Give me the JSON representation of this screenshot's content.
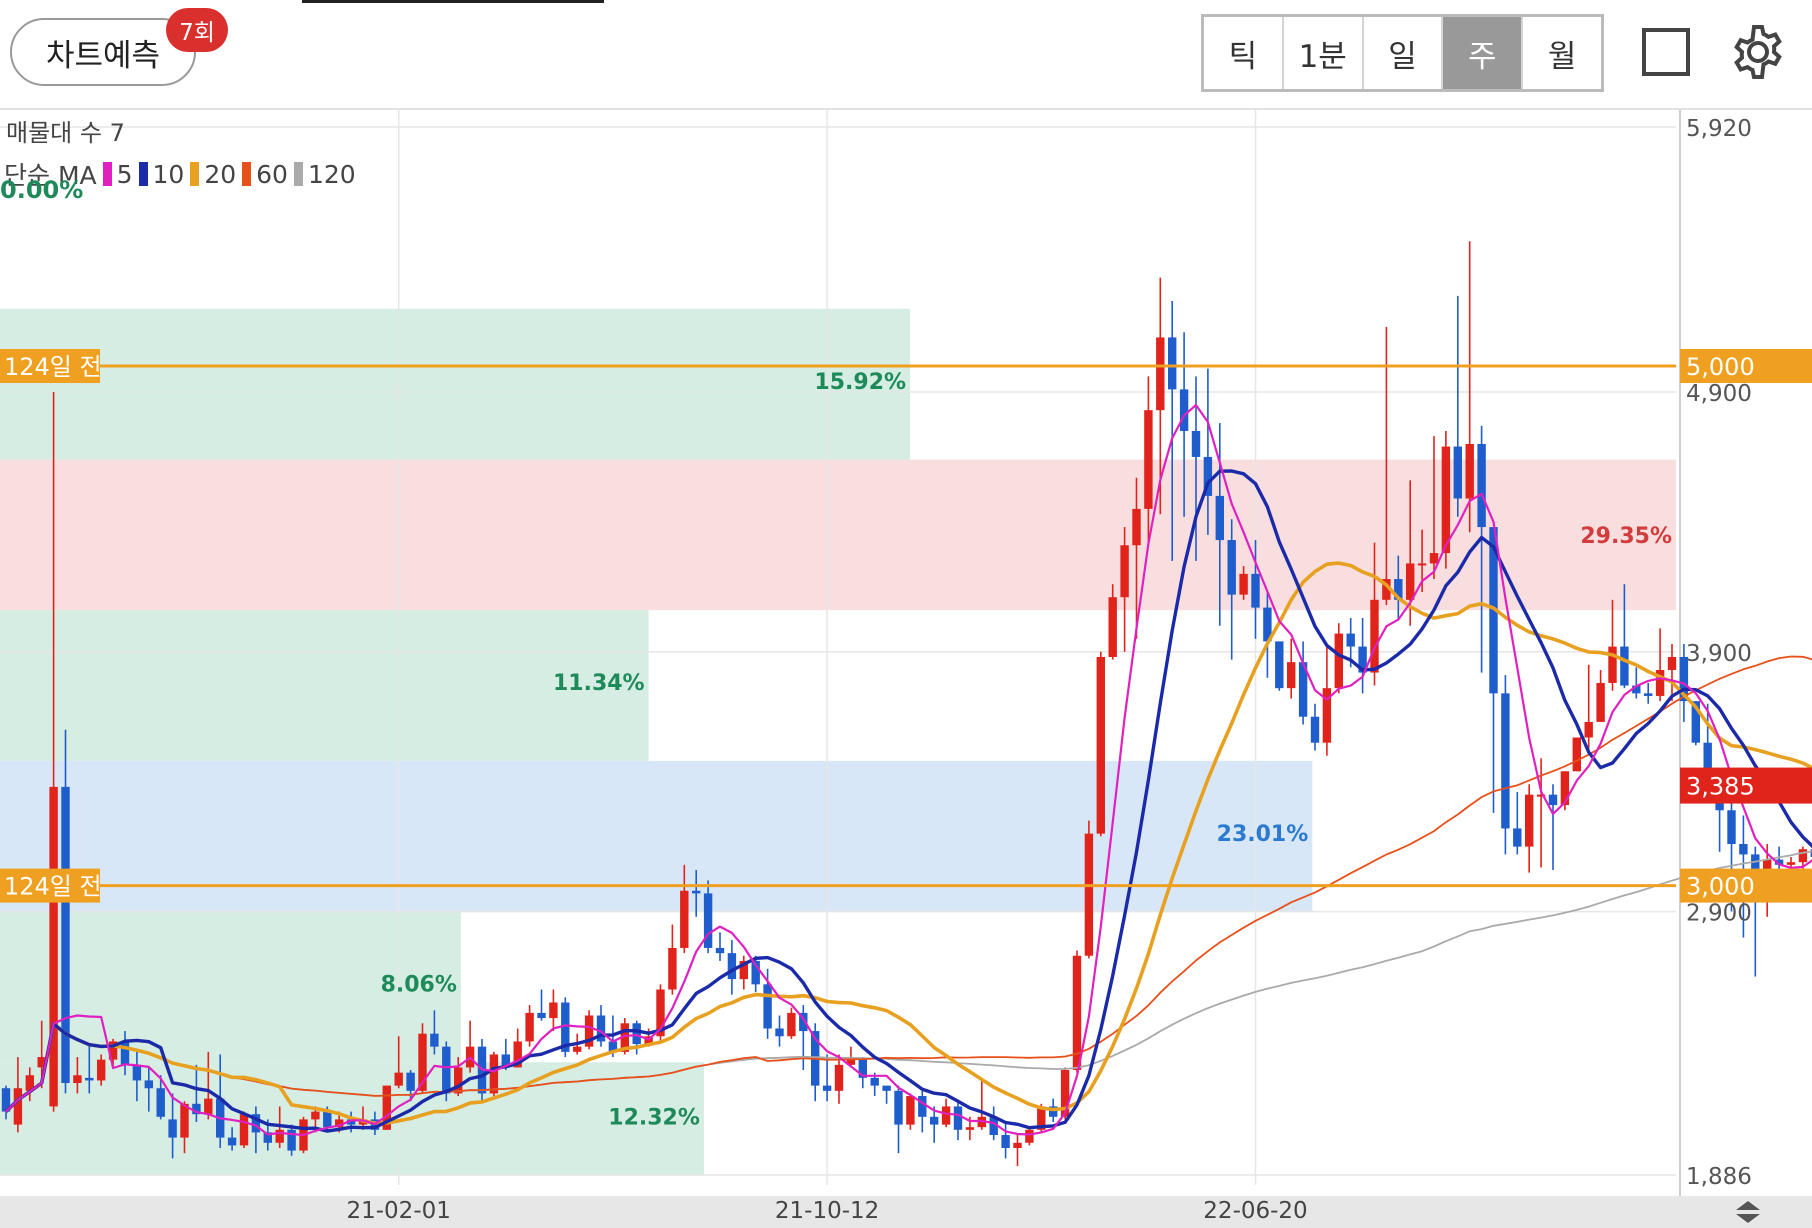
{
  "header": {
    "predict_label": "차트예측",
    "predict_count": "7회",
    "period_tabs": [
      "틱",
      "1분",
      "일",
      "주",
      "월"
    ],
    "active_period": "주"
  },
  "chart_data": {
    "type": "candlestick",
    "info_label": "매물대 수 7",
    "ma_label": "단순 MA",
    "ma_series": [
      {
        "name": "5",
        "color": "#e020c0"
      },
      {
        "name": "10",
        "color": "#1b2aa8"
      },
      {
        "name": "20",
        "color": "#e8a020"
      },
      {
        "name": "60",
        "color": "#e8501a"
      },
      {
        "name": "120",
        "color": "#aaaaaa"
      }
    ],
    "ylim": [
      1886,
      5920
    ],
    "price_labels": [
      {
        "value": 5920,
        "text": "5,920"
      },
      {
        "value": 4900,
        "text": "4,900"
      },
      {
        "value": 3900,
        "text": "3,900"
      },
      {
        "value": 2900,
        "text": "2,900"
      },
      {
        "value": 1886,
        "text": "1,886"
      }
    ],
    "x_labels": [
      {
        "index": 33,
        "text": "21-02-01"
      },
      {
        "index": 69,
        "text": "21-10-12"
      },
      {
        "index": 105,
        "text": "22-06-20"
      }
    ],
    "levels": [
      {
        "value": 5000,
        "left_text": "124일 전",
        "right_text": "5,000",
        "color": "#f0a020"
      },
      {
        "value": 3000,
        "left_text": "124일 전",
        "right_text": "3,000",
        "color": "#f0a020"
      }
    ],
    "current_price": {
      "value": 3385,
      "text": "3,385",
      "color": "#e0231b"
    },
    "volume_profile": [
      {
        "price_low": 4640,
        "price_high": 5220,
        "width_fraction": 0.543,
        "color": "#d6ede3",
        "label": "15.92%",
        "label_color": "#1e8a5a"
      },
      {
        "price_low": 4060,
        "price_high": 4640,
        "width_fraction": 1.0,
        "color": "#f8dede",
        "label": "29.35%",
        "label_color": "#d23c3c"
      },
      {
        "price_low": 3480,
        "price_high": 4060,
        "width_fraction": 0.387,
        "color": "#d6ede3",
        "label": "11.34%",
        "label_color": "#1e8a5a"
      },
      {
        "price_low": 2900,
        "price_high": 3480,
        "width_fraction": 0.783,
        "color": "#d8e7f8",
        "label": "23.01%",
        "label_color": "#2a7ad0"
      },
      {
        "price_low": 2320,
        "price_high": 2900,
        "width_fraction": 0.275,
        "color": "#d6ede3",
        "label": "8.06%",
        "label_color": "#1e8a5a"
      },
      {
        "price_low": 1886,
        "price_high": 2320,
        "width_fraction": 0.42,
        "color": "#d6ede3",
        "label": "12.32%",
        "label_color": "#1e8a5a"
      },
      {
        "price_low": 5220,
        "price_high": 5920,
        "width_fraction": 0.0,
        "color": "#d6ede3",
        "label": "0.00%",
        "label_color": "#1e8a5a"
      }
    ],
    "candles": [
      [
        2220,
        2130,
        2230,
        2100
      ],
      [
        2080,
        2220,
        2340,
        2050
      ],
      [
        2210,
        2270,
        2300,
        2170
      ],
      [
        2300,
        2340,
        2480,
        2220
      ],
      [
        2150,
        3380,
        4900,
        2130
      ],
      [
        3380,
        2240,
        3600,
        2200
      ],
      [
        2240,
        2270,
        2340,
        2200
      ],
      [
        2260,
        2250,
        2390,
        2200
      ],
      [
        2250,
        2330,
        2350,
        2230
      ],
      [
        2330,
        2400,
        2410,
        2300
      ],
      [
        2400,
        2310,
        2440,
        2270
      ],
      [
        2310,
        2250,
        2360,
        2170
      ],
      [
        2250,
        2220,
        2300,
        2130
      ],
      [
        2220,
        2110,
        2270,
        2100
      ],
      [
        2100,
        2030,
        2200,
        1950
      ],
      [
        2030,
        2160,
        2170,
        1970
      ],
      [
        2160,
        2120,
        2310,
        2090
      ],
      [
        2120,
        2180,
        2360,
        2100
      ],
      [
        2180,
        2030,
        2350,
        1990
      ],
      [
        2030,
        2000,
        2070,
        1980
      ],
      [
        2000,
        2120,
        2130,
        1990
      ],
      [
        2120,
        2050,
        2150,
        1970
      ],
      [
        2050,
        2010,
        2100,
        1980
      ],
      [
        2010,
        2060,
        2150,
        1990
      ],
      [
        2060,
        1980,
        2080,
        1960
      ],
      [
        1980,
        2100,
        2110,
        1970
      ],
      [
        2100,
        2130,
        2150,
        2050
      ],
      [
        2130,
        2070,
        2150,
        2050
      ],
      [
        2070,
        2100,
        2130,
        2050
      ],
      [
        2100,
        2080,
        2130,
        2050
      ],
      [
        2080,
        2100,
        2150,
        2060
      ],
      [
        2100,
        2060,
        2130,
        2040
      ],
      [
        2060,
        2230,
        2230,
        2060
      ],
      [
        2230,
        2280,
        2420,
        2220
      ],
      [
        2280,
        2210,
        2290,
        2170
      ],
      [
        2210,
        2430,
        2470,
        2200
      ],
      [
        2430,
        2380,
        2520,
        2350
      ],
      [
        2380,
        2200,
        2400,
        2170
      ],
      [
        2200,
        2300,
        2340,
        2190
      ],
      [
        2300,
        2380,
        2480,
        2280
      ],
      [
        2380,
        2200,
        2410,
        2170
      ],
      [
        2200,
        2350,
        2360,
        2190
      ],
      [
        2350,
        2300,
        2410,
        2290
      ],
      [
        2300,
        2400,
        2450,
        2300
      ],
      [
        2400,
        2510,
        2540,
        2380
      ],
      [
        2510,
        2490,
        2600,
        2480
      ],
      [
        2490,
        2550,
        2600,
        2440
      ],
      [
        2550,
        2360,
        2570,
        2340
      ],
      [
        2360,
        2380,
        2430,
        2350
      ],
      [
        2380,
        2500,
        2520,
        2370
      ],
      [
        2500,
        2400,
        2540,
        2380
      ],
      [
        2400,
        2360,
        2500,
        2340
      ],
      [
        2360,
        2470,
        2490,
        2350
      ],
      [
        2470,
        2390,
        2480,
        2350
      ],
      [
        2390,
        2420,
        2450,
        2380
      ],
      [
        2420,
        2600,
        2620,
        2400
      ],
      [
        2600,
        2760,
        2850,
        2580
      ],
      [
        2760,
        2980,
        3080,
        2740
      ],
      [
        2980,
        2970,
        3060,
        2880
      ],
      [
        2970,
        2760,
        3020,
        2740
      ],
      [
        2760,
        2740,
        2820,
        2710
      ],
      [
        2740,
        2640,
        2790,
        2580
      ],
      [
        2640,
        2710,
        2730,
        2600
      ],
      [
        2710,
        2620,
        2730,
        2590
      ],
      [
        2620,
        2450,
        2680,
        2410
      ],
      [
        2450,
        2420,
        2500,
        2380
      ],
      [
        2420,
        2510,
        2530,
        2410
      ],
      [
        2510,
        2440,
        2540,
        2290
      ],
      [
        2440,
        2230,
        2470,
        2170
      ],
      [
        2230,
        2210,
        2350,
        2170
      ],
      [
        2210,
        2310,
        2350,
        2160
      ],
      [
        2310,
        2330,
        2380,
        2300
      ],
      [
        2330,
        2260,
        2340,
        2220
      ],
      [
        2260,
        2230,
        2280,
        2190
      ],
      [
        2230,
        2210,
        2230,
        2160
      ],
      [
        2210,
        2080,
        2230,
        1970
      ],
      [
        2080,
        2190,
        2200,
        2060
      ],
      [
        2190,
        2110,
        2210,
        2050
      ],
      [
        2110,
        2080,
        2150,
        2010
      ],
      [
        2080,
        2150,
        2180,
        2070
      ],
      [
        2150,
        2060,
        2170,
        2020
      ],
      [
        2060,
        2070,
        2110,
        2020
      ],
      [
        2070,
        2110,
        2260,
        2060
      ],
      [
        2110,
        2040,
        2150,
        2020
      ],
      [
        2040,
        1990,
        2090,
        1950
      ],
      [
        1990,
        2010,
        2040,
        1920
      ],
      [
        2010,
        2060,
        2070,
        2000
      ],
      [
        2060,
        2150,
        2160,
        2050
      ],
      [
        2150,
        2110,
        2180,
        2090
      ],
      [
        2110,
        2290,
        2300,
        2100
      ],
      [
        2290,
        2730,
        2750,
        2280
      ],
      [
        2730,
        3200,
        3250,
        2720
      ],
      [
        3200,
        3880,
        3900,
        3190
      ],
      [
        3880,
        4110,
        4160,
        3870
      ],
      [
        4110,
        4310,
        4380,
        3900
      ],
      [
        4310,
        4450,
        4570,
        3950
      ],
      [
        4450,
        4830,
        4960,
        4310
      ],
      [
        4830,
        5110,
        5340,
        4430
      ],
      [
        5110,
        4910,
        5250,
        4250
      ],
      [
        4910,
        4750,
        5130,
        4420
      ],
      [
        4750,
        4650,
        4960,
        4250
      ],
      [
        4650,
        4500,
        4990,
        4350
      ],
      [
        4500,
        4330,
        4780,
        4000
      ],
      [
        4330,
        4120,
        4410,
        3870
      ],
      [
        4120,
        4200,
        4230,
        4100
      ],
      [
        4200,
        4070,
        4330,
        3950
      ],
      [
        4070,
        3940,
        4130,
        3800
      ],
      [
        3940,
        3760,
        3930,
        3750
      ],
      [
        3760,
        3860,
        3950,
        3720
      ],
      [
        3860,
        3650,
        3940,
        3620
      ],
      [
        3650,
        3550,
        3700,
        3520
      ],
      [
        3550,
        3760,
        3930,
        3500
      ],
      [
        3760,
        3970,
        4010,
        3740
      ],
      [
        3970,
        3920,
        4030,
        3840
      ],
      [
        3920,
        3820,
        4030,
        3740
      ],
      [
        3820,
        4100,
        4320,
        3770
      ],
      [
        4100,
        4180,
        5150,
        4080
      ],
      [
        4180,
        4100,
        4270,
        4020
      ],
      [
        4100,
        4240,
        4560,
        4000
      ],
      [
        4240,
        4240,
        4370,
        4130
      ],
      [
        4240,
        4280,
        4730,
        4180
      ],
      [
        4280,
        4690,
        4750,
        4220
      ],
      [
        4690,
        4490,
        5270,
        4420
      ],
      [
        4490,
        4700,
        5480,
        4360
      ],
      [
        4700,
        4380,
        4770,
        3820
      ],
      [
        4380,
        3740,
        4050,
        3280
      ],
      [
        3740,
        3220,
        3810,
        3120
      ],
      [
        3220,
        3150,
        3360,
        3120
      ],
      [
        3150,
        3350,
        3390,
        3050
      ],
      [
        3350,
        3350,
        3490,
        3070
      ],
      [
        3350,
        3310,
        3390,
        3060
      ],
      [
        3310,
        3440,
        3440,
        3290
      ],
      [
        3440,
        3570,
        3560,
        3440
      ],
      [
        3570,
        3630,
        3850,
        3520
      ],
      [
        3630,
        3780,
        3830,
        3650
      ],
      [
        3780,
        3920,
        4100,
        3750
      ],
      [
        3920,
        3770,
        4160,
        3760
      ],
      [
        3770,
        3740,
        3840,
        3720
      ],
      [
        3740,
        3730,
        3780,
        3700
      ],
      [
        3730,
        3830,
        3990,
        3710
      ],
      [
        3830,
        3880,
        3930,
        3710
      ],
      [
        3880,
        3710,
        3930,
        3630
      ],
      [
        3710,
        3550,
        3690,
        3540
      ],
      [
        3550,
        3390,
        3700,
        3340
      ],
      [
        3390,
        3290,
        3410,
        3130
      ],
      [
        3290,
        3160,
        3330,
        2900
      ],
      [
        3160,
        3120,
        3270,
        2800
      ],
      [
        3120,
        2950,
        3150,
        2650
      ],
      [
        2950,
        3100,
        3160,
        2880
      ],
      [
        3100,
        3080,
        3150,
        2980
      ],
      [
        3080,
        3090,
        3110,
        3000
      ],
      [
        3090,
        3140,
        3150,
        2940
      ],
      [
        3140,
        3110,
        3180,
        3060
      ],
      [
        3110,
        3060,
        3150,
        3020
      ],
      [
        3060,
        3100,
        3150,
        2960
      ],
      [
        3100,
        3390,
        3410,
        3080
      ],
      [
        3390,
        3290,
        3600,
        3040
      ],
      [
        3290,
        3180,
        3480,
        3140
      ],
      [
        3180,
        3130,
        3230,
        3070
      ],
      [
        3130,
        3130,
        3180,
        3040
      ],
      [
        3130,
        2930,
        3170,
        2840
      ],
      [
        2930,
        3270,
        3450,
        2860
      ],
      [
        3270,
        3350,
        3390,
        3210
      ],
      [
        3350,
        3500,
        3580,
        3270
      ],
      [
        3500,
        3490,
        3560,
        3300
      ],
      [
        3490,
        3320,
        3510,
        3280
      ],
      [
        3320,
        3410,
        3500,
        3320
      ],
      [
        3410,
        3470,
        3570,
        3330
      ],
      [
        3470,
        3310,
        3510,
        3300
      ],
      [
        3310,
        3380,
        3450,
        3270
      ],
      [
        3380,
        3500,
        3530,
        3360
      ],
      [
        3500,
        3420,
        3490,
        3360
      ],
      [
        3420,
        3385,
        3490,
        3360
      ]
    ]
  }
}
